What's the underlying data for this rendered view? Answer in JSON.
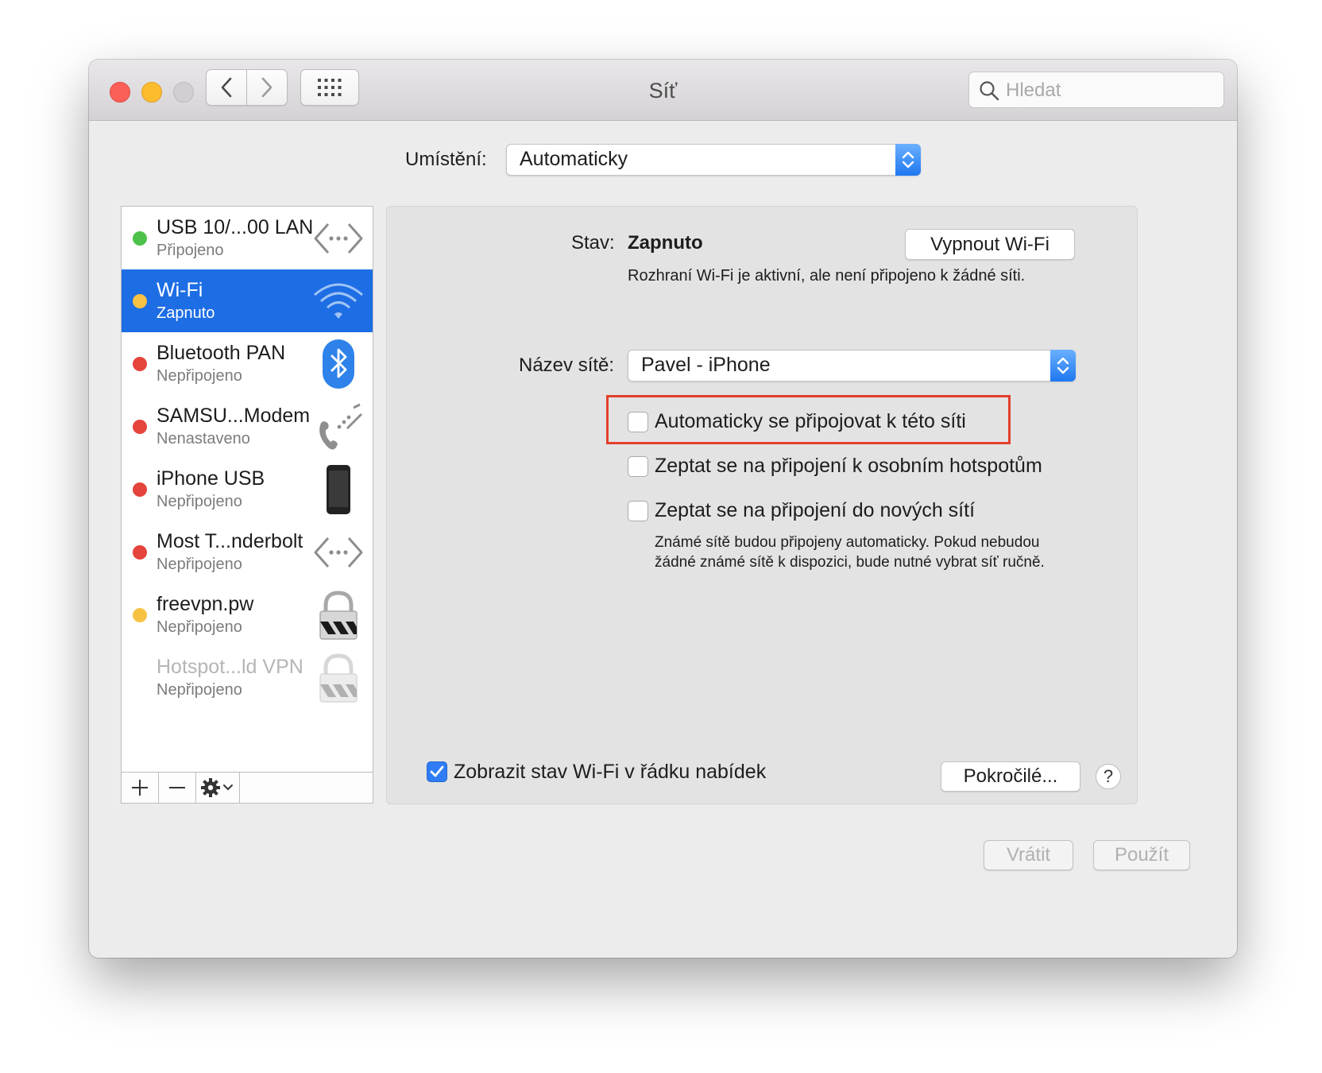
{
  "window": {
    "title": "Síť"
  },
  "toolbar": {
    "search_placeholder": "Hledat"
  },
  "location": {
    "label": "Umístění:",
    "value": "Automaticky"
  },
  "services": [
    {
      "name": "USB 10/...00 LAN",
      "status": "Připojeno",
      "dot_color": "#4cc24a",
      "icon": "ethernet-arrows-icon"
    },
    {
      "name": "Wi-Fi",
      "status": "Zapnuto",
      "dot_color": "#f7c244",
      "icon": "wifi-icon",
      "selected": true
    },
    {
      "name": "Bluetooth PAN",
      "status": "Nepřipojeno",
      "dot_color": "#e5443c",
      "icon": "bluetooth-icon"
    },
    {
      "name": "SAMSU...Modem",
      "status": "Nenastaveno",
      "dot_color": "#e5443c",
      "icon": "phone-modem-icon"
    },
    {
      "name": "iPhone USB",
      "status": "Nepřipojeno",
      "dot_color": "#e5443c",
      "icon": "iphone-icon"
    },
    {
      "name": "Most T...nderbolt",
      "status": "Nepřipojeno",
      "dot_color": "#e5443c",
      "icon": "ethernet-arrows-icon"
    },
    {
      "name": "freevpn.pw",
      "status": "Nepřipojeno",
      "dot_color": "#f7c244",
      "icon": "vpn-lock-icon"
    },
    {
      "name": "Hotspot...ld VPN",
      "status": "Nepřipojeno",
      "dot_color": "",
      "icon": "vpn-lock-icon",
      "disabled": true
    }
  ],
  "wifi": {
    "status_label": "Stav:",
    "status_value": "Zapnuto",
    "turn_off_button": "Vypnout Wi-Fi",
    "status_description": "Rozhraní Wi-Fi je aktivní, ale není připojeno k žádné síti.",
    "network_name_label": "Název sítě:",
    "network_name_value": "Pavel - iPhone",
    "auto_join_label": "Automaticky se připojovat k této síti",
    "auto_join_checked": false,
    "ask_hotspots_label": "Zeptat se na připojení k osobním hotspotům",
    "ask_hotspots_checked": false,
    "ask_new_label": "Zeptat se na připojení do nových sítí",
    "ask_new_checked": false,
    "hint_line1": "Známé sítě budou připojeny automaticky. Pokud nebudou",
    "hint_line2": "žádné známé sítě k dispozici, bude nutné vybrat síť ručně.",
    "show_in_menu_label": "Zobrazit stav Wi-Fi v řádku nabídek",
    "show_in_menu_checked": true,
    "advanced_button": "Pokročilé...",
    "help_button": "?"
  },
  "footer": {
    "revert_button": "Vrátit",
    "apply_button": "Použít"
  },
  "colors": {
    "accent": "#1d6de4",
    "highlight_box": "#e2402d"
  }
}
